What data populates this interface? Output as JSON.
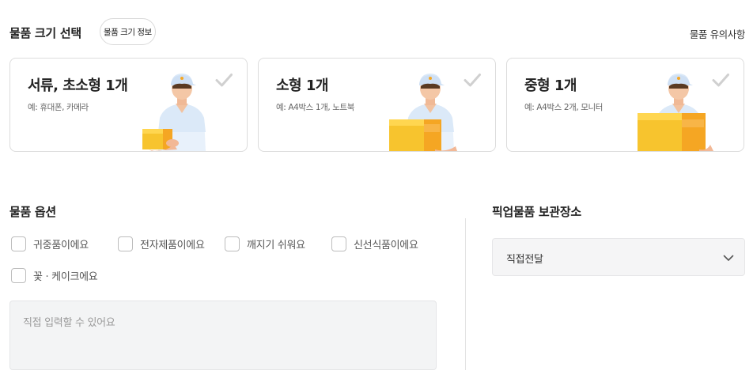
{
  "size_section": {
    "title": "물품 크기 선택",
    "info_button": "물품 크기 정보",
    "notice_link": "물품 유의사항"
  },
  "cards": [
    {
      "title": "서류, 초소형 1개",
      "desc": "예: 휴대폰, 카메라",
      "icon": "check-icon",
      "illustration": "courier-small-box"
    },
    {
      "title": "소형 1개",
      "desc": "예: A4박스 1개, 노트북",
      "icon": "check-icon",
      "illustration": "courier-medium-box"
    },
    {
      "title": "중형 1개",
      "desc": "예: A4박스 2개, 모니터",
      "icon": "check-icon",
      "illustration": "courier-large-box"
    }
  ],
  "options": {
    "title": "물품 옵션",
    "items": [
      {
        "label": "귀중품이에요",
        "checked": false
      },
      {
        "label": "전자제품이에요",
        "checked": false
      },
      {
        "label": "깨지기 쉬워요",
        "checked": false
      },
      {
        "label": "신선식품이에요",
        "checked": false
      },
      {
        "label": "꽃 · 케이크에요",
        "checked": false
      }
    ],
    "memo_placeholder": "직접 입력할 수 있어요"
  },
  "storage": {
    "title": "픽업물품 보관장소",
    "selected": "직접전달",
    "icon": "chevron-down-icon"
  },
  "colors": {
    "check_inactive": "#d0d0d0",
    "box_yellow": "#f7c42e",
    "box_orange": "#f5a623",
    "shirt": "#e8f1fb"
  }
}
